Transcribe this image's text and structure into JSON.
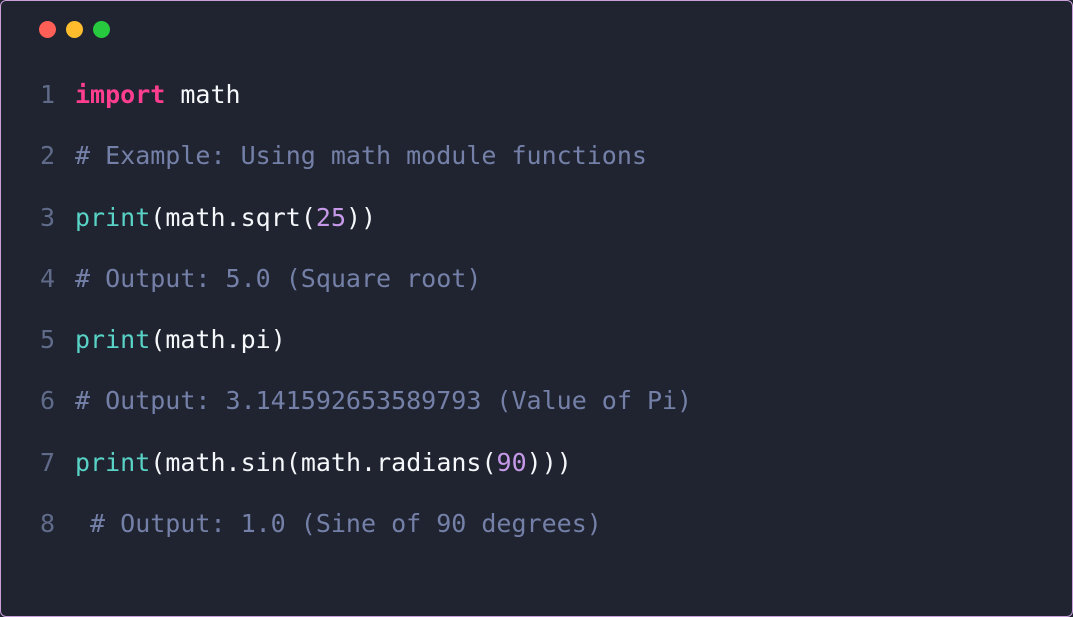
{
  "window": {
    "controls": [
      "close",
      "minimize",
      "maximize"
    ]
  },
  "code": {
    "lines": [
      {
        "n": "1",
        "tokens": [
          {
            "t": "import",
            "c": "tok-keyword"
          },
          {
            "t": " ",
            "c": ""
          },
          {
            "t": "math",
            "c": "tok-module"
          }
        ]
      },
      {
        "n": "2",
        "tokens": [
          {
            "t": "# Example: Using math module functions",
            "c": "tok-comment"
          }
        ]
      },
      {
        "n": "3",
        "tokens": [
          {
            "t": "print",
            "c": "tok-builtin"
          },
          {
            "t": "(",
            "c": "tok-punct"
          },
          {
            "t": "math",
            "c": "tok-ident"
          },
          {
            "t": ".",
            "c": "tok-punct"
          },
          {
            "t": "sqrt",
            "c": "tok-attr"
          },
          {
            "t": "(",
            "c": "tok-punct"
          },
          {
            "t": "25",
            "c": "tok-number"
          },
          {
            "t": "))",
            "c": "tok-punct"
          }
        ]
      },
      {
        "n": "4",
        "tokens": [
          {
            "t": "# Output: 5.0 (Square root)",
            "c": "tok-comment"
          }
        ]
      },
      {
        "n": "5",
        "tokens": [
          {
            "t": "print",
            "c": "tok-builtin"
          },
          {
            "t": "(",
            "c": "tok-punct"
          },
          {
            "t": "math",
            "c": "tok-ident"
          },
          {
            "t": ".",
            "c": "tok-punct"
          },
          {
            "t": "pi",
            "c": "tok-attr"
          },
          {
            "t": ")",
            "c": "tok-punct"
          }
        ]
      },
      {
        "n": "6",
        "tokens": [
          {
            "t": "# Output: 3.141592653589793 (Value of Pi)",
            "c": "tok-comment"
          }
        ]
      },
      {
        "n": "7",
        "tokens": [
          {
            "t": "print",
            "c": "tok-builtin"
          },
          {
            "t": "(",
            "c": "tok-punct"
          },
          {
            "t": "math",
            "c": "tok-ident"
          },
          {
            "t": ".",
            "c": "tok-punct"
          },
          {
            "t": "sin",
            "c": "tok-attr"
          },
          {
            "t": "(",
            "c": "tok-punct"
          },
          {
            "t": "math",
            "c": "tok-ident"
          },
          {
            "t": ".",
            "c": "tok-punct"
          },
          {
            "t": "radians",
            "c": "tok-attr"
          },
          {
            "t": "(",
            "c": "tok-punct"
          },
          {
            "t": "90",
            "c": "tok-number"
          },
          {
            "t": ")))",
            "c": "tok-punct"
          }
        ]
      },
      {
        "n": "8",
        "tokens": [
          {
            "t": " # Output: 1.0 (Sine of 90 degrees)",
            "c": "tok-comment"
          }
        ]
      }
    ]
  }
}
